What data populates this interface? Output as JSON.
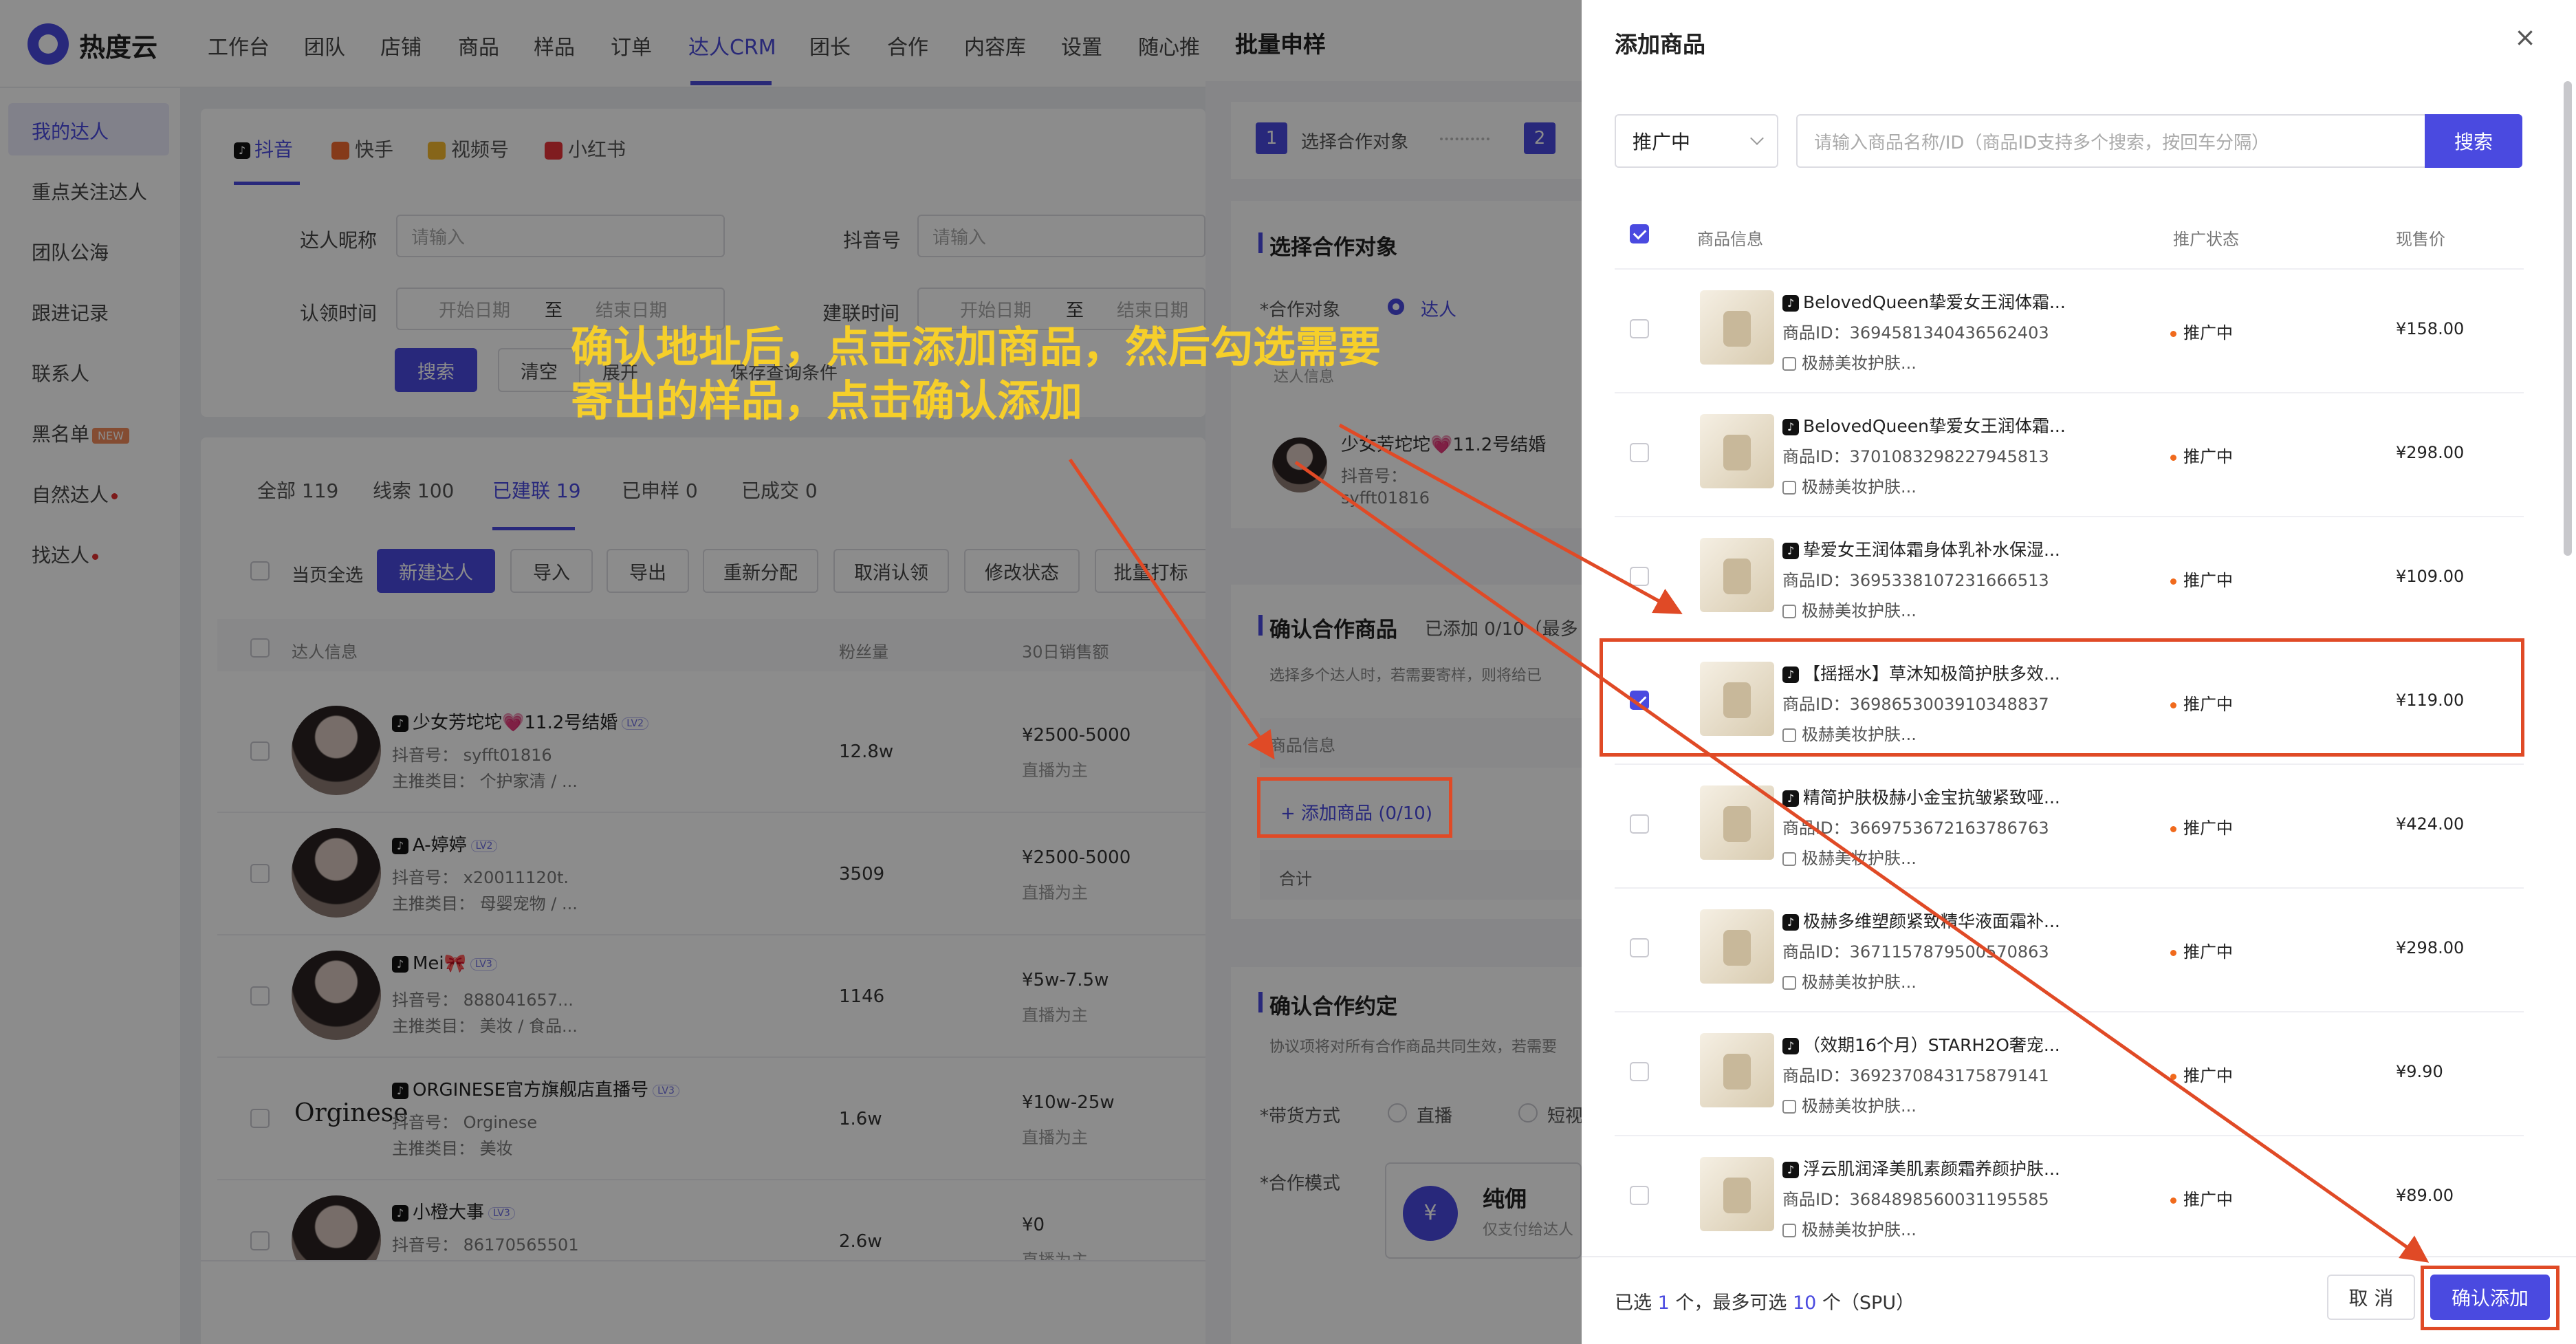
{
  "brand": {
    "name": "热度云",
    "accent": "#4a4ae0"
  },
  "topnav": [
    "工作台",
    "团队",
    "店铺",
    "商品",
    "样品",
    "订单",
    "达人CRM",
    "团长",
    "合作",
    "内容库",
    "设置",
    "随心推"
  ],
  "sidebar": {
    "items": [
      "我的达人",
      "重点关注达人",
      "团队公海",
      "跟进记录",
      "联系人",
      "黑名单",
      "自然达人",
      "找达人"
    ],
    "new_badge": "NEW"
  },
  "platform_tabs": [
    "抖音",
    "快手",
    "视频号",
    "小红书"
  ],
  "filters": {
    "nickname_label": "达人昵称",
    "nickname_ph": "请输入",
    "douyin_label": "抖音号",
    "douyin_ph": "请输入",
    "claim_label": "认领时间",
    "contact_label": "建联时间",
    "start_ph": "开始日期",
    "end_ph": "结束日期",
    "to": "至",
    "search": "搜索",
    "clear": "清空",
    "expand": "展开",
    "save_query": "保存查询条件"
  },
  "status_tabs": [
    "全部 119",
    "线索 100",
    "已建联 19",
    "已申样 0",
    "已成交 0"
  ],
  "actions": {
    "select_all": "当页全选",
    "buttons": [
      "新建达人",
      "导入",
      "导出",
      "重新分配",
      "取消认领",
      "修改状态",
      "批量打标"
    ]
  },
  "table_headers": {
    "info": "达人信息",
    "fans": "粉丝量",
    "sales30": "30日销售额"
  },
  "influencers": [
    {
      "name": "少女芳坨坨💗11.2号结婚",
      "lvl": "LV2",
      "account": "抖音号： syfft01816",
      "category": "主推类目： 个护家清 / ...",
      "fans": "12.8w",
      "sales": "¥2500-5000",
      "mode": "直播为主"
    },
    {
      "name": "A-婷婷",
      "lvl": "LV2",
      "account": "抖音号： x20011120t.",
      "category": "主推类目： 母婴宠物 / ...",
      "fans": "3509",
      "sales": "¥2500-5000",
      "mode": "直播为主"
    },
    {
      "name": "Mei🎀",
      "lvl": "LV3",
      "account": "抖音号： 888041657...",
      "category": "主推类目： 美妆 / 食品...",
      "fans": "1146",
      "sales": "¥5w-7.5w",
      "mode": "直播为主"
    },
    {
      "name": "ORGINESE官方旗舰店直播号",
      "lvl": "LV3",
      "account": "抖音号： Orginese",
      "category": "主推类目： 美妆",
      "fans": "1.6w",
      "sales": "¥10w-25w",
      "mode": "直播为主",
      "logo": "Orginese"
    },
    {
      "name": "小橙大事",
      "lvl": "LV3",
      "account": "抖音号： 86170565501",
      "category": "",
      "fans": "2.6w",
      "sales": "¥0",
      "mode": "直播为主"
    }
  ],
  "drawer": {
    "title": "批量申样",
    "step1": "选择合作对象",
    "step2_num": "2",
    "step1_num": "1",
    "sec1": "选择合作对象",
    "target_label": "*合作对象",
    "target_value": "达人",
    "influencer_info": "达人信息",
    "inf_name": "少女芳坨坨💗11.2号结婚",
    "inf_acct_label": "抖音号：",
    "inf_acct": "syfft01816",
    "sec2": "确认合作商品",
    "sec2_note": "已添加 0/10（最多",
    "tip": "选择多个达人时，若需要寄样，则将给已",
    "prod_info": "商品信息",
    "add_product": "+ 添加商品 (0/10)",
    "total": "合计",
    "sec3": "确认合作约定",
    "sec3_tip": "协议项将对所有合作商品共同生效，若需要",
    "mode_label": "*带货方式",
    "mode_live": "直播",
    "mode_short": "短视",
    "coop_label": "*合作模式",
    "coop_title": "纯佣",
    "coop_sub": "仅支付给达人"
  },
  "modal": {
    "title": "添加商品",
    "status": "推广中",
    "search_ph": "请输入商品名称/ID（商品ID支持多个搜索，按回车分隔）",
    "search_btn": "搜索",
    "headers": {
      "info": "商品信息",
      "status": "推广状态",
      "price": "现售价"
    },
    "products": [
      {
        "name": "BelovedQueen挚爱女王润体霜...",
        "id": "商品ID：3694581340436562403",
        "shop": "极赫美妆护肤...",
        "status": "推广中",
        "price": "¥158.00",
        "checked": false
      },
      {
        "name": "BelovedQueen挚爱女王润体霜...",
        "id": "商品ID：3701083298227945813",
        "shop": "极赫美妆护肤...",
        "status": "推广中",
        "price": "¥298.00",
        "checked": false
      },
      {
        "name": "挚爱女王润体霜身体乳补水保湿...",
        "id": "商品ID：3695338107231666513",
        "shop": "极赫美妆护肤...",
        "status": "推广中",
        "price": "¥109.00",
        "checked": false
      },
      {
        "name": "【摇摇水】草沐知极简护肤多效...",
        "id": "商品ID：3698653003910348837",
        "shop": "极赫美妆护肤...",
        "status": "推广中",
        "price": "¥119.00",
        "checked": true
      },
      {
        "name": "精简护肤极赫小金宝抗皱紧致哑...",
        "id": "商品ID：3669753672163786763",
        "shop": "极赫美妆护肤...",
        "status": "推广中",
        "price": "¥424.00",
        "checked": false
      },
      {
        "name": "极赫多维塑颜紧致精华液面霜补...",
        "id": "商品ID：3671157879500570863",
        "shop": "极赫美妆护肤...",
        "status": "推广中",
        "price": "¥298.00",
        "checked": false
      },
      {
        "name": "（效期16个月）STARH2O奢宠...",
        "id": "商品ID：3692370843175879141",
        "shop": "极赫美妆护肤...",
        "status": "推广中",
        "price": "¥9.90",
        "checked": false
      },
      {
        "name": "浮云肌润泽美肌素颜霜养颜护肤...",
        "id": "商品ID：3684898560031195585",
        "shop": "极赫美妆护肤...",
        "status": "推广中",
        "price": "¥89.00",
        "checked": false
      }
    ],
    "footer_pre": "已选 ",
    "footer_sel": "1",
    "footer_mid": " 个，最多可选 ",
    "footer_max": "10",
    "footer_post": " 个（SPU）",
    "cancel": "取 消",
    "confirm": "确认添加"
  },
  "annotation": {
    "text": "确认地址后，点击添加商品，然后勾选需要寄出的样品，点击确认添加",
    "color": "#f6cf2a",
    "arrow_color": "#e04a26"
  }
}
